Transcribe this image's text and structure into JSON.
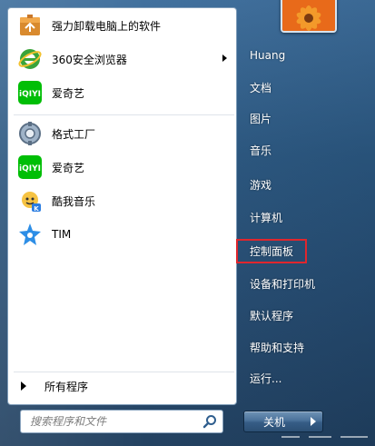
{
  "left_panel": {
    "programs": [
      {
        "label": "强力卸载电脑上的软件",
        "icon": "uninstall-box-icon",
        "has_submenu": false
      },
      {
        "label": "360安全浏览器",
        "icon": "360-browser-icon",
        "has_submenu": true
      },
      {
        "label": "爱奇艺",
        "icon": "iqiyi-icon",
        "has_submenu": false
      },
      {
        "label": "格式工厂",
        "icon": "format-factory-icon",
        "has_submenu": false
      },
      {
        "label": "爱奇艺",
        "icon": "iqiyi-icon",
        "has_submenu": false
      },
      {
        "label": "酷我音乐",
        "icon": "kuwo-music-icon",
        "has_submenu": false
      },
      {
        "label": "TIM",
        "icon": "tim-star-icon",
        "has_submenu": false
      }
    ],
    "all_programs_label": "所有程序",
    "search_placeholder": "搜索程序和文件"
  },
  "right_panel": {
    "user_name": "Huang",
    "items": [
      {
        "label": "文档"
      },
      {
        "label": "图片"
      },
      {
        "label": "音乐"
      },
      {
        "label": "游戏"
      },
      {
        "label": "计算机"
      },
      {
        "label": "控制面板",
        "highlighted": true
      },
      {
        "label": "设备和打印机"
      },
      {
        "label": "默认程序"
      },
      {
        "label": "帮助和支持"
      },
      {
        "label": "运行..."
      }
    ],
    "shutdown_label": "关机"
  },
  "colors": {
    "frame": "#2a567f",
    "highlight_border": "#e0262d",
    "iqiyi_green": "#00be06",
    "browser_green": "#3aa43a"
  }
}
